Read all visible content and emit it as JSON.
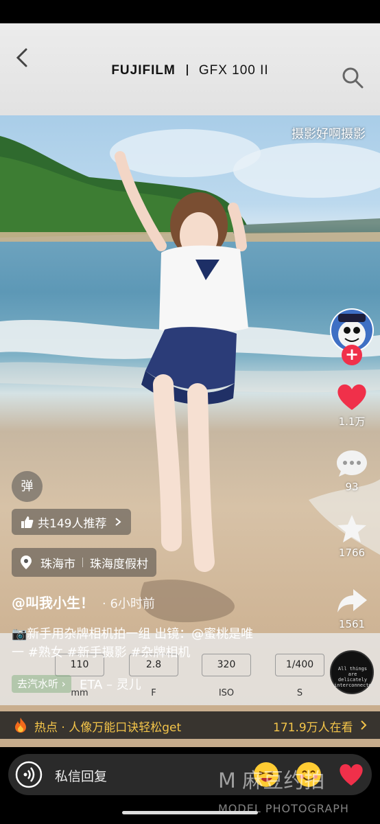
{
  "header": {
    "brand": "FUJIFILM",
    "model": "GFX 100 II"
  },
  "overlay_watermark": "摄影好啊摄影",
  "actions": {
    "likes": "1.1万",
    "comments": "93",
    "favorites": "1766",
    "shares": "1561"
  },
  "danmu_label": "弹",
  "recommend_label": "共149人推荐",
  "location": {
    "city": "珠海市",
    "place": "珠海度假村"
  },
  "author": {
    "name": "@叫我小生！",
    "time": "· 6小时前"
  },
  "caption": {
    "line1": "📷新手用杂牌相机拍一组 出镜：@蜜桃是唯",
    "line2": "一 #熟女 #新手摄影 #杂牌相机"
  },
  "exif": [
    {
      "value": "110",
      "label": "mm"
    },
    {
      "value": "2.8",
      "label": "F"
    },
    {
      "value": "320",
      "label": "ISO"
    },
    {
      "value": "1/400",
      "label": "S"
    }
  ],
  "music": {
    "tag": "去汽水听 ›",
    "name": "ETA – 灵儿",
    "disc_text": "All things are delicately interconnected"
  },
  "hot": {
    "text": "热点 · 人像万能口诀轻松get",
    "viewers": "171.9万人在看"
  },
  "reply": {
    "placeholder": "私信回复"
  },
  "bottom_watermark": {
    "main": "M 麻豆约拍",
    "sub": "MODEL PHOTOGRAPH"
  },
  "colors": {
    "like_red": "#f0304a",
    "hot_yellow": "#f4c54a"
  }
}
